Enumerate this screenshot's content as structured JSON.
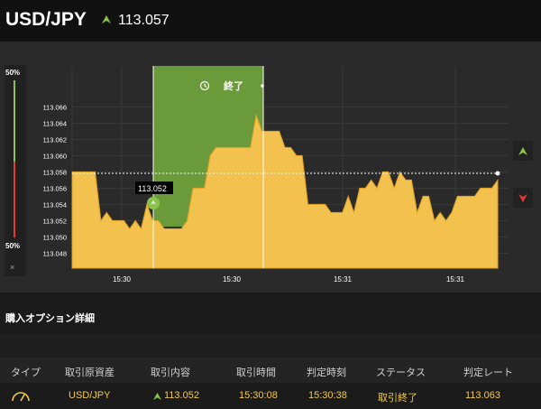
{
  "header": {
    "pair": "USD/JPY",
    "price": "113.057",
    "price_icon": "up-arrow-icon"
  },
  "chart_data": {
    "type": "area",
    "y_ticks": [
      "113.066",
      "113.064",
      "113.062",
      "113.060",
      "113.058",
      "113.056",
      "113.054",
      "113.052",
      "113.050",
      "113.048"
    ],
    "x_ticks": [
      "15:30",
      "15:30",
      "15:31",
      "15:31"
    ],
    "current_rate": 113.057,
    "entry_marker_label": "113.052",
    "expiry_label": "終了",
    "series": [
      {
        "values": [
          113.058,
          113.058,
          113.058,
          113.058,
          113.058,
          113.052,
          113.053,
          113.052,
          113.052,
          113.052,
          113.051,
          113.052,
          113.051,
          113.054,
          113.052,
          113.052,
          113.051,
          113.051,
          113.051,
          113.051,
          113.052,
          113.056,
          113.056,
          113.056,
          113.06,
          113.061,
          113.061,
          113.061,
          113.061,
          113.061,
          113.061,
          113.061,
          113.065,
          113.063,
          113.063,
          113.063,
          113.063,
          113.061,
          113.061,
          113.06,
          113.06,
          113.054,
          113.054,
          113.054,
          113.054,
          113.053,
          113.053,
          113.053,
          113.055,
          113.053,
          113.056,
          113.056,
          113.057,
          113.056,
          113.058,
          113.058,
          113.056,
          113.058,
          113.057,
          113.057,
          113.053,
          113.055,
          113.055,
          113.052,
          113.053,
          113.052,
          113.053,
          113.055,
          113.055,
          113.055,
          113.055,
          113.056,
          113.056,
          113.056,
          113.057
        ]
      }
    ],
    "colors": {
      "area": "#f2c14e",
      "highlight": "#6a9a3a",
      "up": "#8bc34a",
      "down": "#e53935"
    }
  },
  "sidebar": {
    "top_pct": "50%",
    "bottom_pct": "50%",
    "close": "×"
  },
  "details": {
    "title": "購入オプション詳細",
    "columns": [
      "タイプ",
      "取引原資産",
      "取引内容",
      "取引時間",
      "判定時刻",
      "ステータス",
      "判定レート"
    ],
    "row": {
      "asset": "USD/JPY",
      "content": "113.052",
      "trade_time": "15:30:08",
      "judge_time": "15:30:38",
      "status": "取引終了",
      "rate": "113.063"
    }
  }
}
